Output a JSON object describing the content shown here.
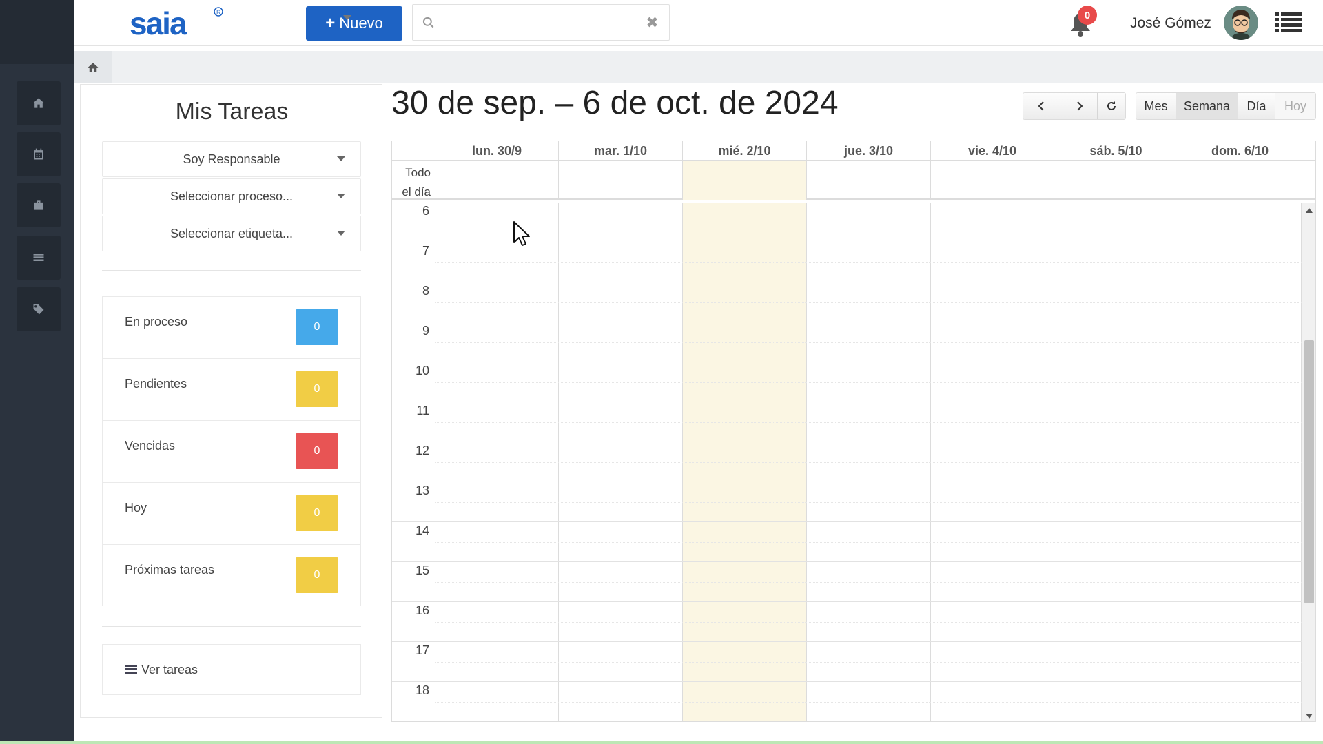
{
  "header": {
    "logo_text": "saia",
    "new_button_label": "Nuevo",
    "search_placeholder": "",
    "notification_count": "0",
    "user_name": "José Gómez"
  },
  "sidebar": {
    "items": [
      {
        "icon": "home-icon"
      },
      {
        "icon": "calendar-icon"
      },
      {
        "icon": "briefcase-icon"
      },
      {
        "icon": "list-icon"
      },
      {
        "icon": "tag-icon"
      }
    ]
  },
  "panel": {
    "title": "Mis Tareas",
    "filters": [
      {
        "label": "Soy Responsable"
      },
      {
        "label": "Seleccionar proceso..."
      },
      {
        "label": "Seleccionar etiqueta..."
      }
    ],
    "stats": [
      {
        "label": "En proceso",
        "count": "0",
        "color": "#45a9ea"
      },
      {
        "label": "Pendientes",
        "count": "0",
        "color": "#f1cd45"
      },
      {
        "label": "Vencidas",
        "count": "0",
        "color": "#e85454"
      },
      {
        "label": "Hoy",
        "count": "0",
        "color": "#f1cd45"
      },
      {
        "label": "Próximas tareas",
        "count": "0",
        "color": "#f1cd45"
      }
    ],
    "view_tasks_label": "Ver tareas"
  },
  "calendar": {
    "title": "30 de sep. – 6 de oct. de 2024",
    "views": {
      "month": "Mes",
      "week": "Semana",
      "day": "Día",
      "today": "Hoy"
    },
    "active_view": "Semana",
    "days": [
      "lun. 30/9",
      "mar. 1/10",
      "mié. 2/10",
      "jue. 3/10",
      "vie. 4/10",
      "sáb. 5/10",
      "dom. 6/10"
    ],
    "today_index": 2,
    "allday_label_1": "Todo",
    "allday_label_2": "el día",
    "hours": [
      "6",
      "7",
      "8",
      "9",
      "10",
      "11",
      "12",
      "13",
      "14",
      "15",
      "16",
      "17",
      "18"
    ],
    "today_highlight_color": "#fbf6e3"
  }
}
